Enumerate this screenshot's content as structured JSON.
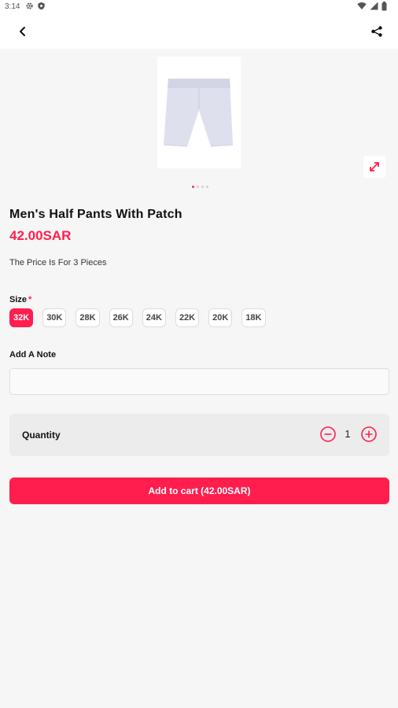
{
  "status": {
    "time": "3:14"
  },
  "product": {
    "title": "Men's Half Pants With Patch",
    "price": "42.00SAR",
    "description": "The Price Is For 3 Pieces",
    "carousel": {
      "count": 4,
      "active": 0
    }
  },
  "size": {
    "label": "Size",
    "required_mark": "*",
    "options": [
      "32K",
      "30K",
      "28K",
      "26K",
      "24K",
      "22K",
      "20K",
      "18K"
    ],
    "selected": "32K"
  },
  "note": {
    "label": "Add A Note",
    "value": "",
    "placeholder": ""
  },
  "quantity": {
    "label": "Quantity",
    "value": "1"
  },
  "cart": {
    "button_label": "Add to cart (42.00SAR)"
  },
  "colors": {
    "accent": "#ff1e4e",
    "background": "#f6f6f6",
    "chip_border": "#dcdcdc"
  },
  "icons": {
    "back": "arrow-left-icon",
    "share": "share-icon",
    "expand": "expand-icon",
    "minus": "minus-circle-icon",
    "plus": "plus-circle-icon"
  }
}
